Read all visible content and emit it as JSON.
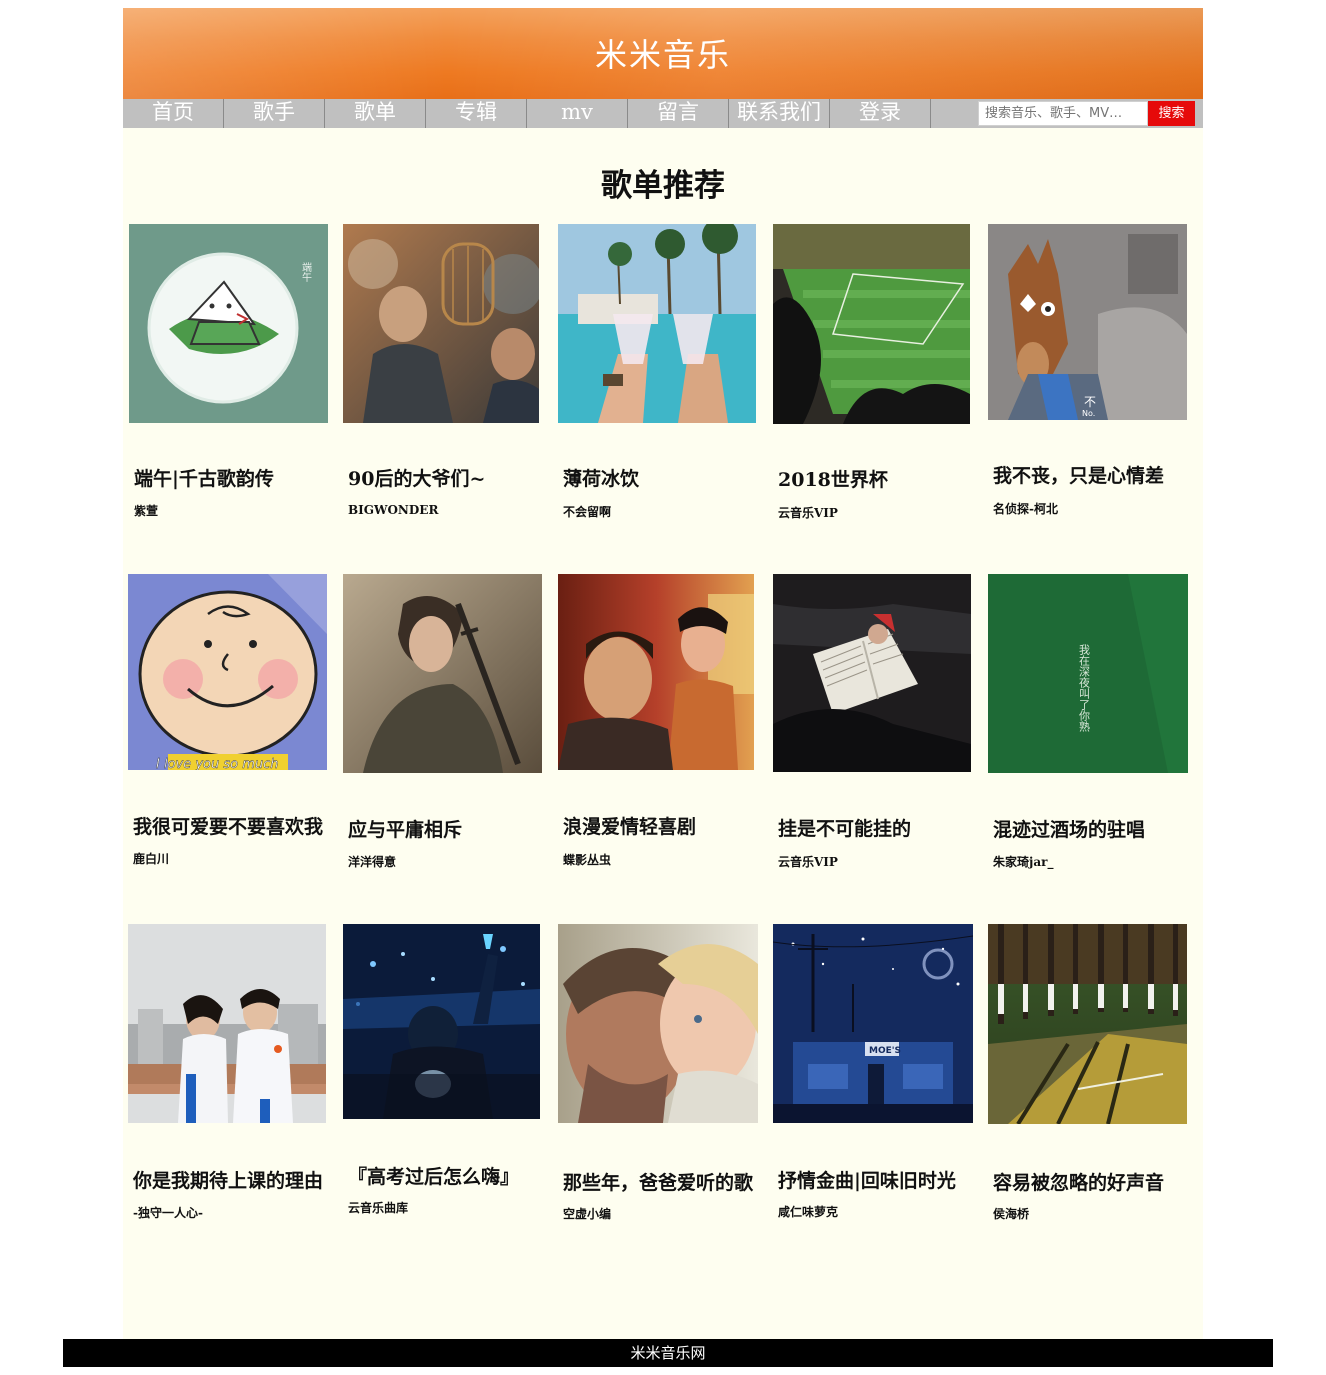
{
  "header": {
    "title": "米米音乐"
  },
  "nav": {
    "items": [
      {
        "label": "首页"
      },
      {
        "label": "歌手"
      },
      {
        "label": "歌单"
      },
      {
        "label": "专辑"
      },
      {
        "label": "mv"
      },
      {
        "label": "留言"
      },
      {
        "label": "联系我们"
      },
      {
        "label": "登录"
      }
    ],
    "search_placeholder": "搜索音乐、歌手、MV…",
    "search_button": "搜索"
  },
  "section": {
    "title": "歌单推荐"
  },
  "playlists": [
    {
      "title": "端午|千古歌韵传",
      "author": "紫萱"
    },
    {
      "title": "90后的大爷们~",
      "author": "BIGWONDER"
    },
    {
      "title": "薄荷冰饮",
      "author": "不会留啊"
    },
    {
      "title": "2018世界杯",
      "author": "云音乐VIP"
    },
    {
      "title": "我不丧，只是心情差",
      "author": "名侦探-柯北"
    },
    {
      "title": "我很可爱要不要喜欢我",
      "author": "鹿白川"
    },
    {
      "title": "应与平庸相斥",
      "author": "洋洋得意"
    },
    {
      "title": "浪漫爱情轻喜剧",
      "author": "蝶影丛虫"
    },
    {
      "title": "挂是不可能挂的",
      "author": "云音乐VIP"
    },
    {
      "title": "混迹过酒场的驻唱",
      "author": "朱家琦jar_"
    },
    {
      "title": "你是我期待上课的理由",
      "author": "-独守一人心-"
    },
    {
      "title": "『高考过后怎么嗨』",
      "author": "云音乐曲库"
    },
    {
      "title": "那些年，爸爸爱听的歌",
      "author": "空虚小编"
    },
    {
      "title": "抒情金曲|回味旧时光",
      "author": "咸仁味萝克"
    },
    {
      "title": "容易被忽略的好声音",
      "author": "侯海桥"
    }
  ],
  "cover_texts": {
    "duanwu": "端午",
    "bojack": "不",
    "bojack_sub": "No.",
    "peanuts": "I love you so much",
    "green_poem": "我在深夜叫了你熟",
    "moes": "MOE'S"
  },
  "colors": {
    "accent": "#ee7a22",
    "nav_bg": "#c0c0c0",
    "search_btn": "#e60a0a",
    "page_bg": "#fefef0"
  },
  "footer": {
    "text": "米米音乐网"
  }
}
